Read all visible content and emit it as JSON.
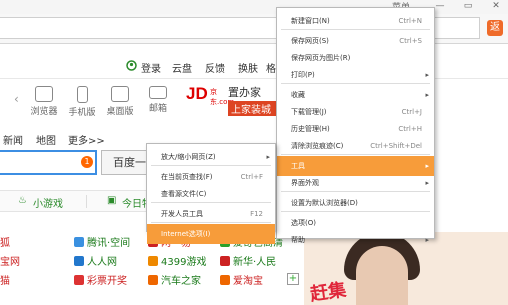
{
  "window": {
    "title_fragment": "菜单",
    "min_glyph": "—",
    "restore_glyph": "▭",
    "close_glyph": "✕"
  },
  "toolbar": {
    "orange_button_glyph": "返"
  },
  "toplinks": {
    "login": "登录",
    "cloud": "云盘",
    "feedback": "反馈",
    "skin": "换肤",
    "more": "格"
  },
  "icons_row": {
    "back_glyph": "‹",
    "items": [
      {
        "label": "浏览器",
        "icon": "browser-icon"
      },
      {
        "label": "手机版",
        "icon": "mobile-icon"
      },
      {
        "label": "桌面版",
        "icon": "desktop-icon"
      },
      {
        "label": "邮箱",
        "icon": "mail-icon"
      }
    ]
  },
  "ads": {
    "jd": "JD",
    "jd_sub": "京东.com",
    "zhujia_line1": "置办家",
    "zhujia_line2": "上家装城"
  },
  "nav": {
    "news": "新闻",
    "map": "地图",
    "more": "更多>>"
  },
  "search": {
    "badge": "1",
    "button_label": "百度一下"
  },
  "bar2": {
    "games": "小游戏",
    "deals": "今日特价"
  },
  "sites": [
    {
      "label": "狐",
      "color": "#cc2222",
      "dot": ""
    },
    {
      "label": "腾讯·空间",
      "color": "#1a7a1a",
      "dot": "#3a90e0"
    },
    {
      "label": "网　易",
      "color": "#cc2222",
      "dot": "#cc2222"
    },
    {
      "label": "爱奇艺高清",
      "color": "#1a7a1a",
      "dot": "#2aa02a"
    },
    {
      "label": "宝网",
      "color": "#cc2222",
      "dot": ""
    },
    {
      "label": "人人网",
      "color": "#1a7a1a",
      "dot": "#2277cc"
    },
    {
      "label": "4399游戏",
      "color": "#1a7a1a",
      "dot": "#ee8800"
    },
    {
      "label": "新华·人民",
      "color": "#1a7a1a",
      "dot": "#cc2222"
    },
    {
      "label": "猫",
      "color": "#cc2222",
      "dot": ""
    },
    {
      "label": "彩票开奖",
      "color": "#cc2222",
      "dot": "#dd3333"
    },
    {
      "label": "汽车之家",
      "color": "#1a7a1a",
      "dot": "#ee6600"
    },
    {
      "label": "爱淘宝",
      "color": "#cc2222",
      "dot": "#ee6600"
    }
  ],
  "sites_plus": "+",
  "promo": {
    "text": "赶集"
  },
  "main_menu": {
    "items": [
      {
        "label": "新建窗口(N)",
        "shortcut": "Ctrl+N",
        "arrow": ""
      },
      {
        "label": "保存网页(S)",
        "shortcut": "Ctrl+S",
        "arrow": ""
      },
      {
        "label": "保存网页为图片(R)",
        "shortcut": "",
        "arrow": ""
      },
      {
        "label": "打印(P)",
        "shortcut": "",
        "arrow": "▸"
      },
      {
        "label": "收藏",
        "shortcut": "",
        "arrow": "▸"
      },
      {
        "label": "下载管理(J)",
        "shortcut": "Ctrl+J",
        "arrow": ""
      },
      {
        "label": "历史管理(H)",
        "shortcut": "Ctrl+H",
        "arrow": ""
      },
      {
        "label": "清除浏览痕迹(C)",
        "shortcut": "Ctrl+Shift+Del",
        "arrow": ""
      },
      {
        "label": "工具",
        "shortcut": "",
        "arrow": "▸"
      },
      {
        "label": "界面外观",
        "shortcut": "",
        "arrow": "▸"
      },
      {
        "label": "设置为默认浏览器(D)",
        "shortcut": "",
        "arrow": ""
      },
      {
        "label": "选项(O)",
        "shortcut": "",
        "arrow": ""
      },
      {
        "label": "帮助",
        "shortcut": "",
        "arrow": "▸"
      }
    ],
    "highlight_index": 8
  },
  "tools_submenu": {
    "items": [
      {
        "label": "放大/缩小网页(Z)",
        "shortcut": "",
        "arrow": "▸"
      },
      {
        "label": "在当前页查找(F)",
        "shortcut": "Ctrl+F",
        "arrow": ""
      },
      {
        "label": "查看源文件(C)",
        "shortcut": "",
        "arrow": ""
      },
      {
        "label": "开发人员工具",
        "shortcut": "F12",
        "arrow": ""
      },
      {
        "label": "Internet选项(I)",
        "shortcut": "",
        "arrow": ""
      }
    ],
    "highlight_index": 4
  },
  "colors": {
    "highlight": "#f79c3a",
    "accent_orange": "#ef6b2a",
    "link_green": "#1a7a1a"
  }
}
